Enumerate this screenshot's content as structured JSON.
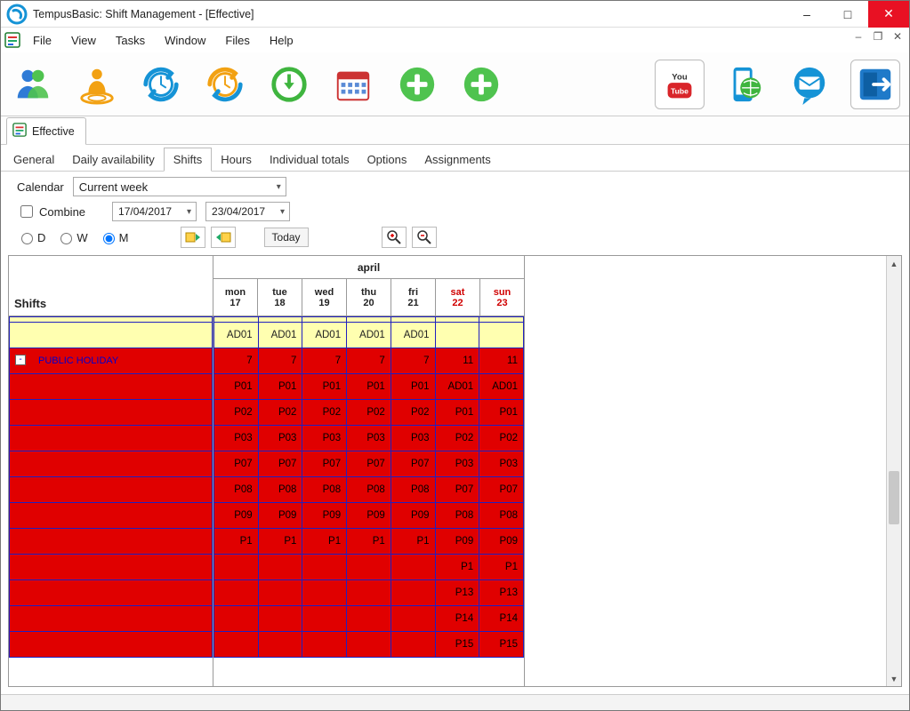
{
  "window": {
    "title": "TempusBasic: Shift Management - [Effective]"
  },
  "menu": {
    "items": [
      "File",
      "View",
      "Tasks",
      "Window",
      "Files",
      "Help"
    ]
  },
  "doc_tab": {
    "label": "Effective"
  },
  "subtabs": [
    "General",
    "Daily availability",
    "Shifts",
    "Hours",
    "Individual totals",
    "Options",
    "Assignments"
  ],
  "subtab_active_index": 2,
  "filter": {
    "calendar_label": "Calendar",
    "calendar_value": "Current week",
    "combine_label": "Combine",
    "combine_checked": false,
    "date_from": "17/04/2017",
    "date_to": "23/04/2017",
    "view_modes": {
      "d": "D",
      "w": "W",
      "m": "M",
      "selected": "M"
    },
    "today_label": "Today"
  },
  "grid": {
    "left_header": "Shifts",
    "month": "april",
    "days": [
      {
        "dow": "mon",
        "num": "17",
        "weekend": false
      },
      {
        "dow": "tue",
        "num": "18",
        "weekend": false
      },
      {
        "dow": "wed",
        "num": "19",
        "weekend": false
      },
      {
        "dow": "thu",
        "num": "20",
        "weekend": false
      },
      {
        "dow": "fri",
        "num": "21",
        "weekend": false
      },
      {
        "dow": "sat",
        "num": "22",
        "weekend": true
      },
      {
        "dow": "sun",
        "num": "23",
        "weekend": true
      }
    ],
    "rows": [
      {
        "type": "admin-top",
        "label": "",
        "cells": [
          "",
          "",
          "",
          "",
          "",
          "",
          ""
        ]
      },
      {
        "type": "admin",
        "label": "",
        "cells": [
          "AD01",
          "AD01",
          "AD01",
          "AD01",
          "AD01",
          "",
          ""
        ]
      },
      {
        "type": "holiday-header",
        "label": "PUBLIC HOLIDAY",
        "cells": [
          "7",
          "7",
          "7",
          "7",
          "7",
          "11",
          "11"
        ]
      },
      {
        "type": "holiday",
        "label": "",
        "cells": [
          "P01",
          "P01",
          "P01",
          "P01",
          "P01",
          "AD01",
          "AD01"
        ]
      },
      {
        "type": "holiday",
        "label": "",
        "cells": [
          "P02",
          "P02",
          "P02",
          "P02",
          "P02",
          "P01",
          "P01"
        ]
      },
      {
        "type": "holiday",
        "label": "",
        "cells": [
          "P03",
          "P03",
          "P03",
          "P03",
          "P03",
          "P02",
          "P02"
        ]
      },
      {
        "type": "holiday",
        "label": "",
        "cells": [
          "P07",
          "P07",
          "P07",
          "P07",
          "P07",
          "P03",
          "P03"
        ]
      },
      {
        "type": "holiday",
        "label": "",
        "cells": [
          "P08",
          "P08",
          "P08",
          "P08",
          "P08",
          "P07",
          "P07"
        ]
      },
      {
        "type": "holiday",
        "label": "",
        "cells": [
          "P09",
          "P09",
          "P09",
          "P09",
          "P09",
          "P08",
          "P08"
        ]
      },
      {
        "type": "holiday",
        "label": "",
        "cells": [
          "P1",
          "P1",
          "P1",
          "P1",
          "P1",
          "P09",
          "P09"
        ]
      },
      {
        "type": "holiday",
        "label": "",
        "cells": [
          "",
          "",
          "",
          "",
          "",
          "P1",
          "P1"
        ]
      },
      {
        "type": "holiday",
        "label": "",
        "cells": [
          "",
          "",
          "",
          "",
          "",
          "P13",
          "P13"
        ]
      },
      {
        "type": "holiday",
        "label": "",
        "cells": [
          "",
          "",
          "",
          "",
          "",
          "P14",
          "P14"
        ]
      },
      {
        "type": "holiday",
        "label": "",
        "cells": [
          "",
          "",
          "",
          "",
          "",
          "P15",
          "P15"
        ]
      }
    ]
  },
  "icons": {
    "people": "people-icon",
    "person_target": "person-target-icon",
    "clock_cycle_blue": "clock-cycle-blue-icon",
    "clock_cycle_orange": "clock-cycle-orange-icon",
    "clock_down_green": "clock-down-green-icon",
    "calendar": "calendar-icon",
    "plus1": "plus-icon",
    "plus2": "plus-icon",
    "youtube": "youtube-icon",
    "mobile_globe": "mobile-globe-icon",
    "mail_bubble": "mail-bubble-icon",
    "exit": "exit-icon"
  }
}
